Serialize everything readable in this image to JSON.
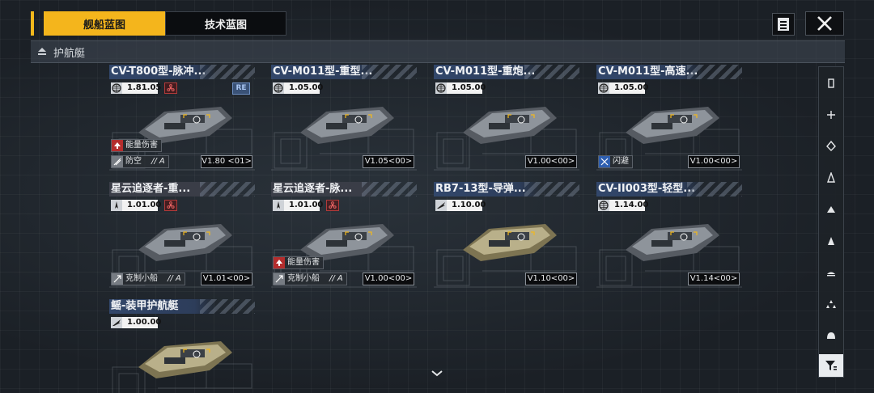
{
  "tabs": [
    {
      "label": "舰船蓝图",
      "active": true
    },
    {
      "label": "技术蓝图",
      "active": false
    }
  ],
  "category": {
    "label": "护航艇"
  },
  "cards": [
    {
      "title": "CV-T800型-脉冲...",
      "version": "1.81.05",
      "type_icon": "globe-icon",
      "tech_icon": "atom-icon",
      "badge": "RE",
      "traits": [
        {
          "label": "能量伤害",
          "style": "red",
          "icon": "arrow-up-icon"
        },
        {
          "label": "防空",
          "grade": "// A",
          "style": "grey",
          "icon": "aa-icon"
        }
      ],
      "version_tag": "V1.80 <01>"
    },
    {
      "title": "CV-M011型-重型...",
      "version": "1.05.00",
      "type_icon": "globe-icon",
      "traits": [],
      "version_tag": "V1.05<00>"
    },
    {
      "title": "CV-M011型-重炮...",
      "version": "1.05.00",
      "type_icon": "globe-icon",
      "traits": [],
      "version_tag": "V1.00<00>"
    },
    {
      "title": "CV-M011型-高速...",
      "version": "1.05.00",
      "type_icon": "globe-icon",
      "traits": [
        {
          "label": "闪避",
          "style": "blue",
          "icon": "evade-icon"
        }
      ],
      "version_tag": "V1.00<00>"
    },
    {
      "title": "星云追逐者-重...",
      "version": "1.01.00",
      "type_icon": "thrust-icon",
      "tech_icon": "atom-icon",
      "traits": [
        {
          "label": "克制小船",
          "grade": "// A",
          "style": "grey",
          "icon": "counter-icon"
        }
      ],
      "version_tag": "V1.01<00>"
    },
    {
      "title": "星云追逐者-脉...",
      "version": "1.01.00",
      "type_icon": "thrust-icon",
      "tech_icon": "atom-icon",
      "traits": [
        {
          "label": "能量伤害",
          "style": "red",
          "icon": "arrow-up-icon"
        },
        {
          "label": "克制小船",
          "grade": "// A",
          "style": "grey",
          "icon": "counter-icon"
        }
      ],
      "version_tag": "V1.00<00>"
    },
    {
      "title": "RB7-13型-导弹...",
      "version": "1.10.00",
      "type_icon": "wing-icon",
      "traits": [],
      "version_tag": "V1.10<00>"
    },
    {
      "title": "CV-II003型-轻型...",
      "version": "1.14.00",
      "type_icon": "globe-icon",
      "traits": [],
      "version_tag": "V1.14<00>"
    },
    {
      "title": "鳐-装甲护航艇",
      "version": "1.00.00",
      "type_icon": "wing-icon",
      "traits": [],
      "version_tag": ""
    }
  ],
  "rail_icons": [
    "frigate-icon",
    "destroyer-icon",
    "cruiser-icon",
    "battlecruiser-icon",
    "carrier-icon",
    "corvette-icon",
    "auxiliary-icon",
    "fighter-icon",
    "station-icon"
  ],
  "colors": {
    "accent": "#f4b51c",
    "title_bar": "#32476b",
    "red_trait": "#b42d2d",
    "blue_trait": "#2f5fb0"
  }
}
